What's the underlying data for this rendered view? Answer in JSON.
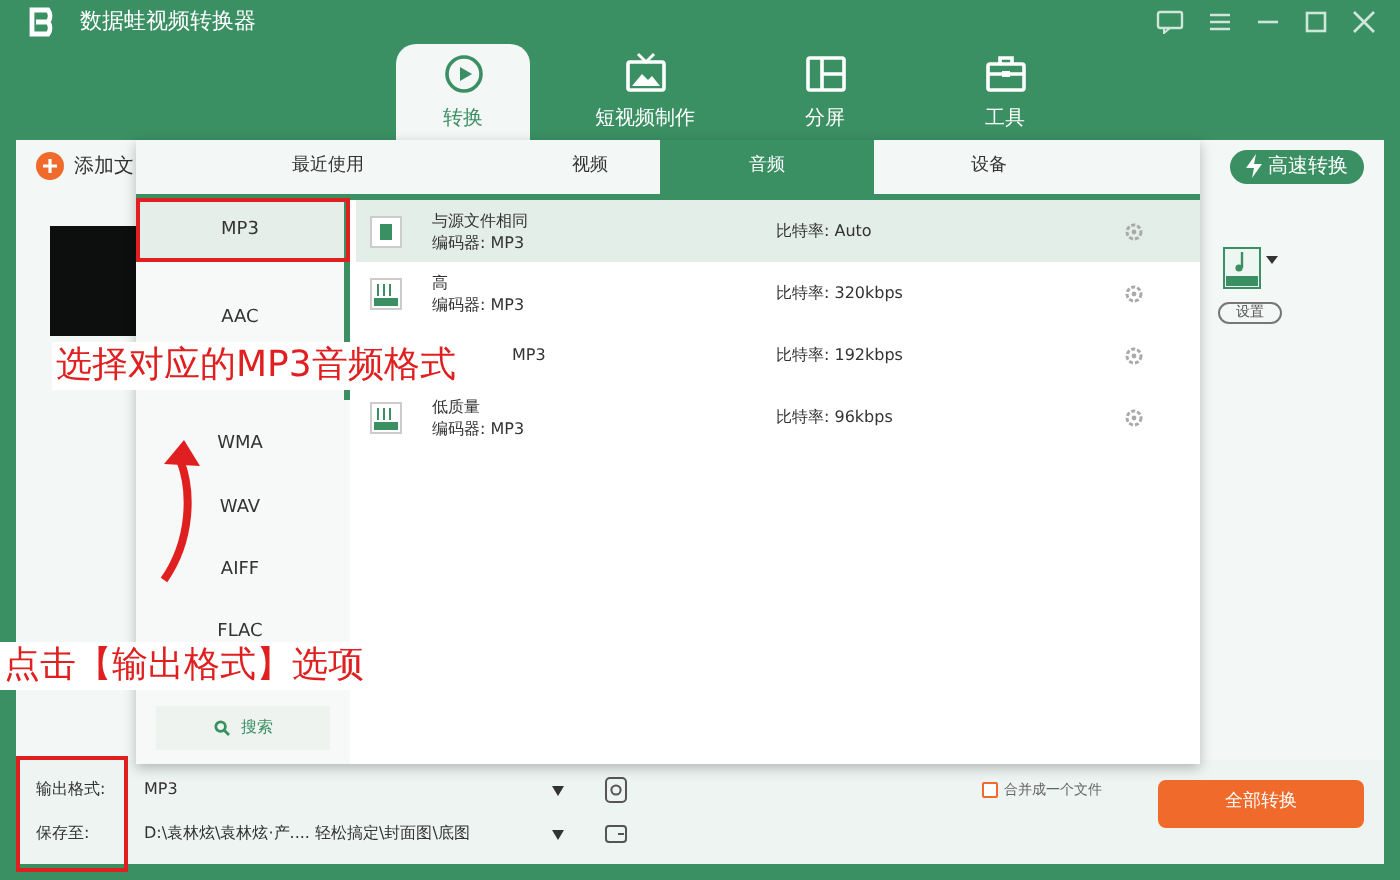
{
  "window": {
    "title": "数据蛙视频转换器"
  },
  "nav_tabs": [
    {
      "label": "转换",
      "selected": true
    },
    {
      "label": "短视频制作",
      "selected": false
    },
    {
      "label": "分屏",
      "selected": false
    },
    {
      "label": "工具",
      "selected": false
    }
  ],
  "toolbar": {
    "add_files": "添加文",
    "fast_convert": "高速转换"
  },
  "file_item": {
    "settings": "设置"
  },
  "format_popup": {
    "tabs": [
      {
        "label": "最近使用",
        "selected": false
      },
      {
        "label": "视频",
        "selected": false
      },
      {
        "label": "音频",
        "selected": true
      },
      {
        "label": "设备",
        "selected": false
      }
    ],
    "formats": [
      {
        "label": "MP3",
        "selected": true
      },
      {
        "label": "AAC",
        "selected": false
      },
      {
        "label": "WMA",
        "selected": false
      },
      {
        "label": "WAV",
        "selected": false
      },
      {
        "label": "AIFF",
        "selected": false
      },
      {
        "label": "FLAC",
        "selected": false
      }
    ],
    "search": "搜索",
    "presets": [
      {
        "title": "与源文件相同",
        "encoder_label": "编码器:",
        "encoder": "MP3",
        "bitrate_label": "比特率:",
        "bitrate": "Auto",
        "selected": true
      },
      {
        "title": "高",
        "encoder_label": "编码器:",
        "encoder": "MP3",
        "bitrate_label": "比特率:",
        "bitrate": "320kbps",
        "selected": false
      },
      {
        "encoder": "MP3",
        "bitrate_label": "比特率:",
        "bitrate": "192kbps",
        "selected": false
      },
      {
        "title": "低质量",
        "encoder_label": "编码器:",
        "encoder": "MP3",
        "bitrate_label": "比特率:",
        "bitrate": "96kbps",
        "selected": false
      }
    ]
  },
  "bottom": {
    "output_format_label": "输出格式:",
    "output_format": "MP3",
    "save_to_label": "保存至:",
    "save_path": "D:\\袁林炫\\袁林炫·产.... 轻松搞定\\封面图\\底图",
    "merge": {
      "label": "合并成一个文件",
      "checked": false
    },
    "convert_button": "全部转换"
  },
  "annotations": [
    {
      "text": "选择对应的MP3音频格式"
    },
    {
      "text": "点击【输出格式】选项"
    }
  ]
}
